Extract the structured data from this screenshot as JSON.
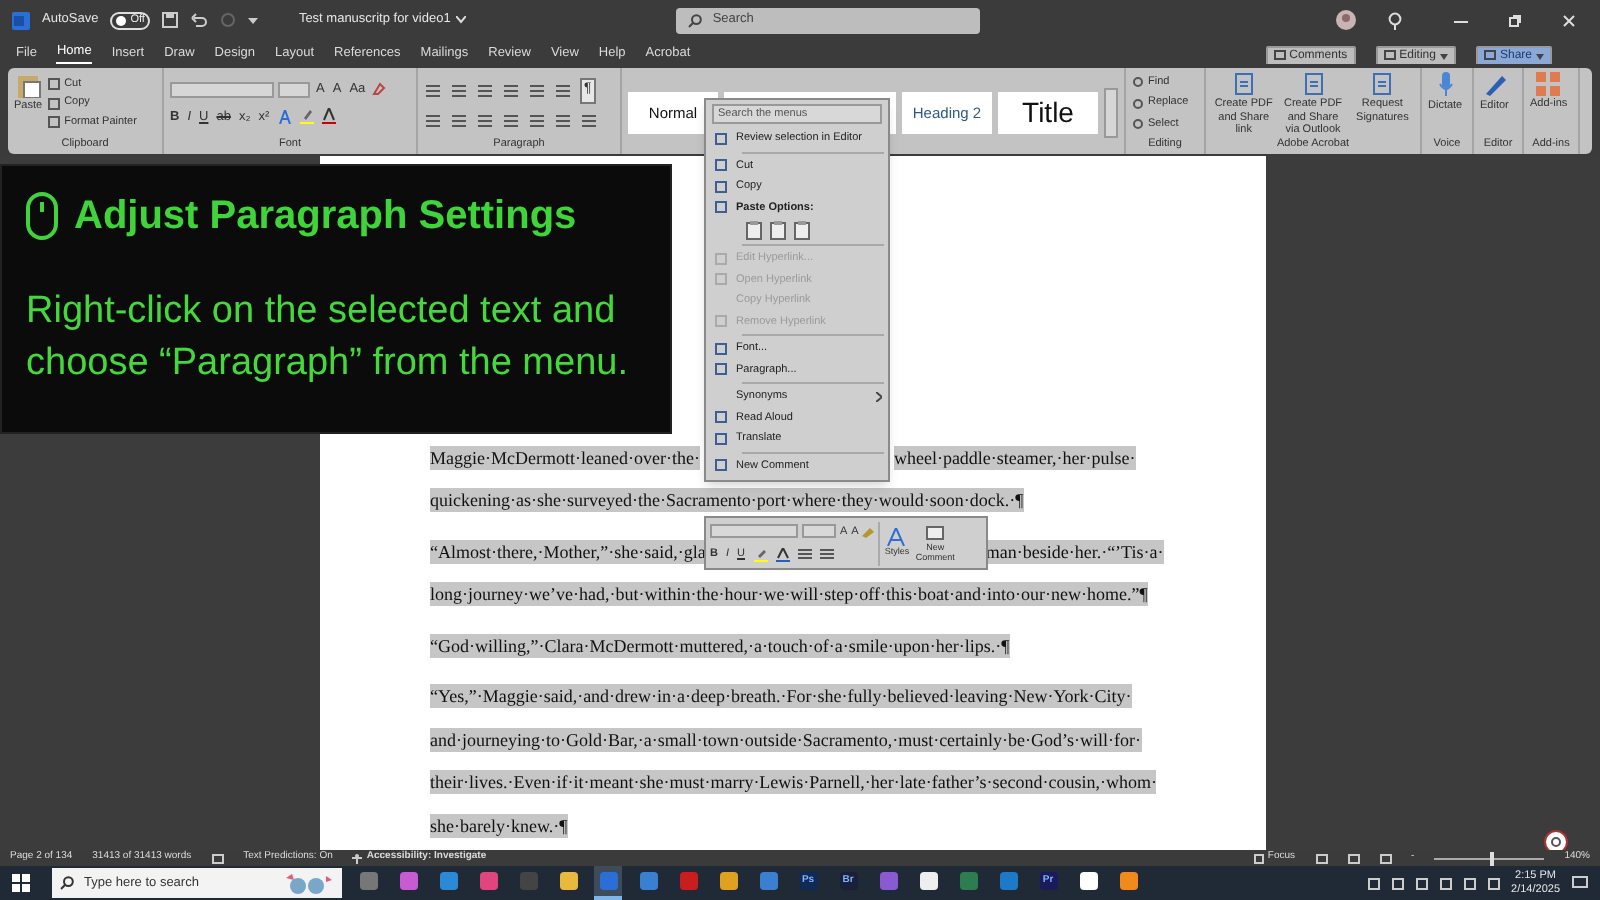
{
  "title_bar": {
    "autosave_label": "AutoSave",
    "autosave_on": false,
    "autosave_state": "Off",
    "document_title": "Test manuscritp for video1",
    "search_placeholder": "Search"
  },
  "menu_tabs": [
    {
      "label": "File",
      "selected": false
    },
    {
      "label": "Home",
      "selected": true
    },
    {
      "label": "Insert",
      "selected": false
    },
    {
      "label": "Draw",
      "selected": false
    },
    {
      "label": "Design",
      "selected": false
    },
    {
      "label": "Layout",
      "selected": false
    },
    {
      "label": "References",
      "selected": false
    },
    {
      "label": "Mailings",
      "selected": false
    },
    {
      "label": "Review",
      "selected": false
    },
    {
      "label": "View",
      "selected": false
    },
    {
      "label": "Help",
      "selected": false
    },
    {
      "label": "Acrobat",
      "selected": false
    }
  ],
  "header_buttons": [
    {
      "label": "Comments",
      "kind": "plain"
    },
    {
      "label": "Editing",
      "kind": "dropdown"
    },
    {
      "label": "Share",
      "kind": "primary"
    }
  ],
  "ribbon": {
    "clipboard": {
      "name": "Clipboard",
      "paste": "Paste",
      "actions": [
        "Cut",
        "Copy",
        "Format Painter"
      ]
    },
    "font": {
      "name": "Font",
      "size_buttons": [
        "A",
        "A",
        "Aa"
      ],
      "format_buttons": [
        "B",
        "I",
        "U",
        "ab",
        "x₂",
        "x²"
      ]
    },
    "paragraph": {
      "name": "Paragraph",
      "show_marks": {
        "label": "¶",
        "selected": true
      }
    },
    "styles": [
      {
        "label": "Normal"
      },
      {
        "label": "Heading 2"
      },
      {
        "label": "Title"
      }
    ],
    "editing": {
      "name": "Editing",
      "actions": [
        "Find",
        "Replace",
        "Select"
      ]
    },
    "acrobat": {
      "name": "Adobe Acrobat",
      "actions": [
        "Create PDF and Share link",
        "Create PDF and Share via Outlook",
        "Request Signatures"
      ]
    },
    "voice": {
      "name": "Voice",
      "action": "Dictate"
    },
    "editor": {
      "name": "Editor",
      "action": "Editor"
    },
    "addins": {
      "name": "Add-ins",
      "action": "Add-ins"
    }
  },
  "overlay": {
    "title": "Adjust Paragraph Settings",
    "body": "Right-click on the selected text and choose “Paragraph” from the menu."
  },
  "document": {
    "paragraphs": [
      {
        "lines": [
          [
            "Maggie·McDermott·leaned·over·the·",
            "wheel·paddle·steamer,·her·pulse·"
          ],
          [
            "quickening·as·she·surveyed·the·Sacramento·port·where·they·would·soon·dock.·¶"
          ]
        ]
      },
      {
        "lines": [
          [
            "“Almost·there,·Mother,”·she·said,·gla",
            "man·beside·her.·“’Tis·a·"
          ],
          [
            "long·journey·we’ve·had,·but·within·the·hour·we·will·step·off·this·boat·and·into·our·new·home.”¶"
          ]
        ]
      },
      {
        "lines": [
          [
            "“God·willing,”·Clara·McDermott·muttered,·a·touch·of·a·smile·upon·her·lips.·¶"
          ]
        ]
      },
      {
        "lines": [
          [
            "“Yes,”·Maggie·said,·and·drew·in·a·deep·breath.·For·she·fully·believed·leaving·New·York·City·"
          ],
          [
            "and·journeying·to·Gold·Bar,·a·small·town·outside·Sacramento,·must·certainly·be·God’s·will·for·"
          ],
          [
            "their·lives.·Even·if·it·meant·she·must·marry·Lewis·Parnell,·her·late·father’s·second·cousin,·whom·"
          ],
          [
            "she·barely·knew.·¶"
          ]
        ]
      }
    ]
  },
  "context_menu": {
    "search_placeholder": "Search the menus",
    "items": [
      {
        "kind": "item",
        "label": "Review selection in Editor",
        "disabled": false
      },
      {
        "kind": "separator"
      },
      {
        "kind": "item",
        "label": "Cut",
        "disabled": false
      },
      {
        "kind": "item",
        "label": "Copy",
        "disabled": false
      },
      {
        "kind": "heading",
        "label": "Paste Options:"
      },
      {
        "kind": "paste-icons"
      },
      {
        "kind": "separator"
      },
      {
        "kind": "item",
        "label": "Edit Hyperlink...",
        "disabled": true
      },
      {
        "kind": "item",
        "label": "Open Hyperlink",
        "disabled": true
      },
      {
        "kind": "item",
        "label": "Copy Hyperlink",
        "disabled": true
      },
      {
        "kind": "item",
        "label": "Remove Hyperlink",
        "disabled": true
      },
      {
        "kind": "separator"
      },
      {
        "kind": "item",
        "label": "Font...",
        "disabled": false
      },
      {
        "kind": "item",
        "label": "Paragraph...",
        "disabled": false
      },
      {
        "kind": "separator"
      },
      {
        "kind": "item",
        "label": "Synonyms",
        "disabled": false,
        "submenu": true
      },
      {
        "kind": "item",
        "label": "Read Aloud",
        "disabled": false
      },
      {
        "kind": "item",
        "label": "Translate",
        "disabled": false
      },
      {
        "kind": "separator"
      },
      {
        "kind": "item",
        "label": "New Comment",
        "disabled": false
      }
    ]
  },
  "mini_toolbar": {
    "size_buttons": [
      "A",
      "A"
    ],
    "format_buttons": [
      "B",
      "I",
      "U"
    ],
    "styles": "Styles",
    "new_comment": "New Comment"
  },
  "status_bar": {
    "left": [
      "Page 2 of 134",
      "31413 of 31413 words",
      "Text Predictions: On",
      "Accessibility: Investigate"
    ],
    "focus": "Focus",
    "zoom": {
      "zoom_out": "-",
      "level": 0.5,
      "reading": "140%"
    }
  },
  "taskbar": {
    "search_placeholder": "Type here to search",
    "apps": [
      {
        "selected": false
      },
      {
        "selected": false
      },
      {
        "selected": false
      },
      {
        "selected": false
      },
      {
        "selected": false
      },
      {
        "selected": false
      },
      {
        "selected": true
      },
      {
        "selected": false
      },
      {
        "selected": false
      },
      {
        "selected": false
      },
      {
        "selected": false
      },
      {
        "label": "Ps",
        "selected": false
      },
      {
        "label": "Br",
        "selected": false
      },
      {
        "selected": false
      },
      {
        "selected": false
      },
      {
        "selected": false
      },
      {
        "selected": false
      },
      {
        "label": "Pr",
        "selected": false
      },
      {
        "selected": false
      },
      {
        "selected": false
      }
    ],
    "time": "2:15 PM",
    "date": "2/14/2025"
  }
}
